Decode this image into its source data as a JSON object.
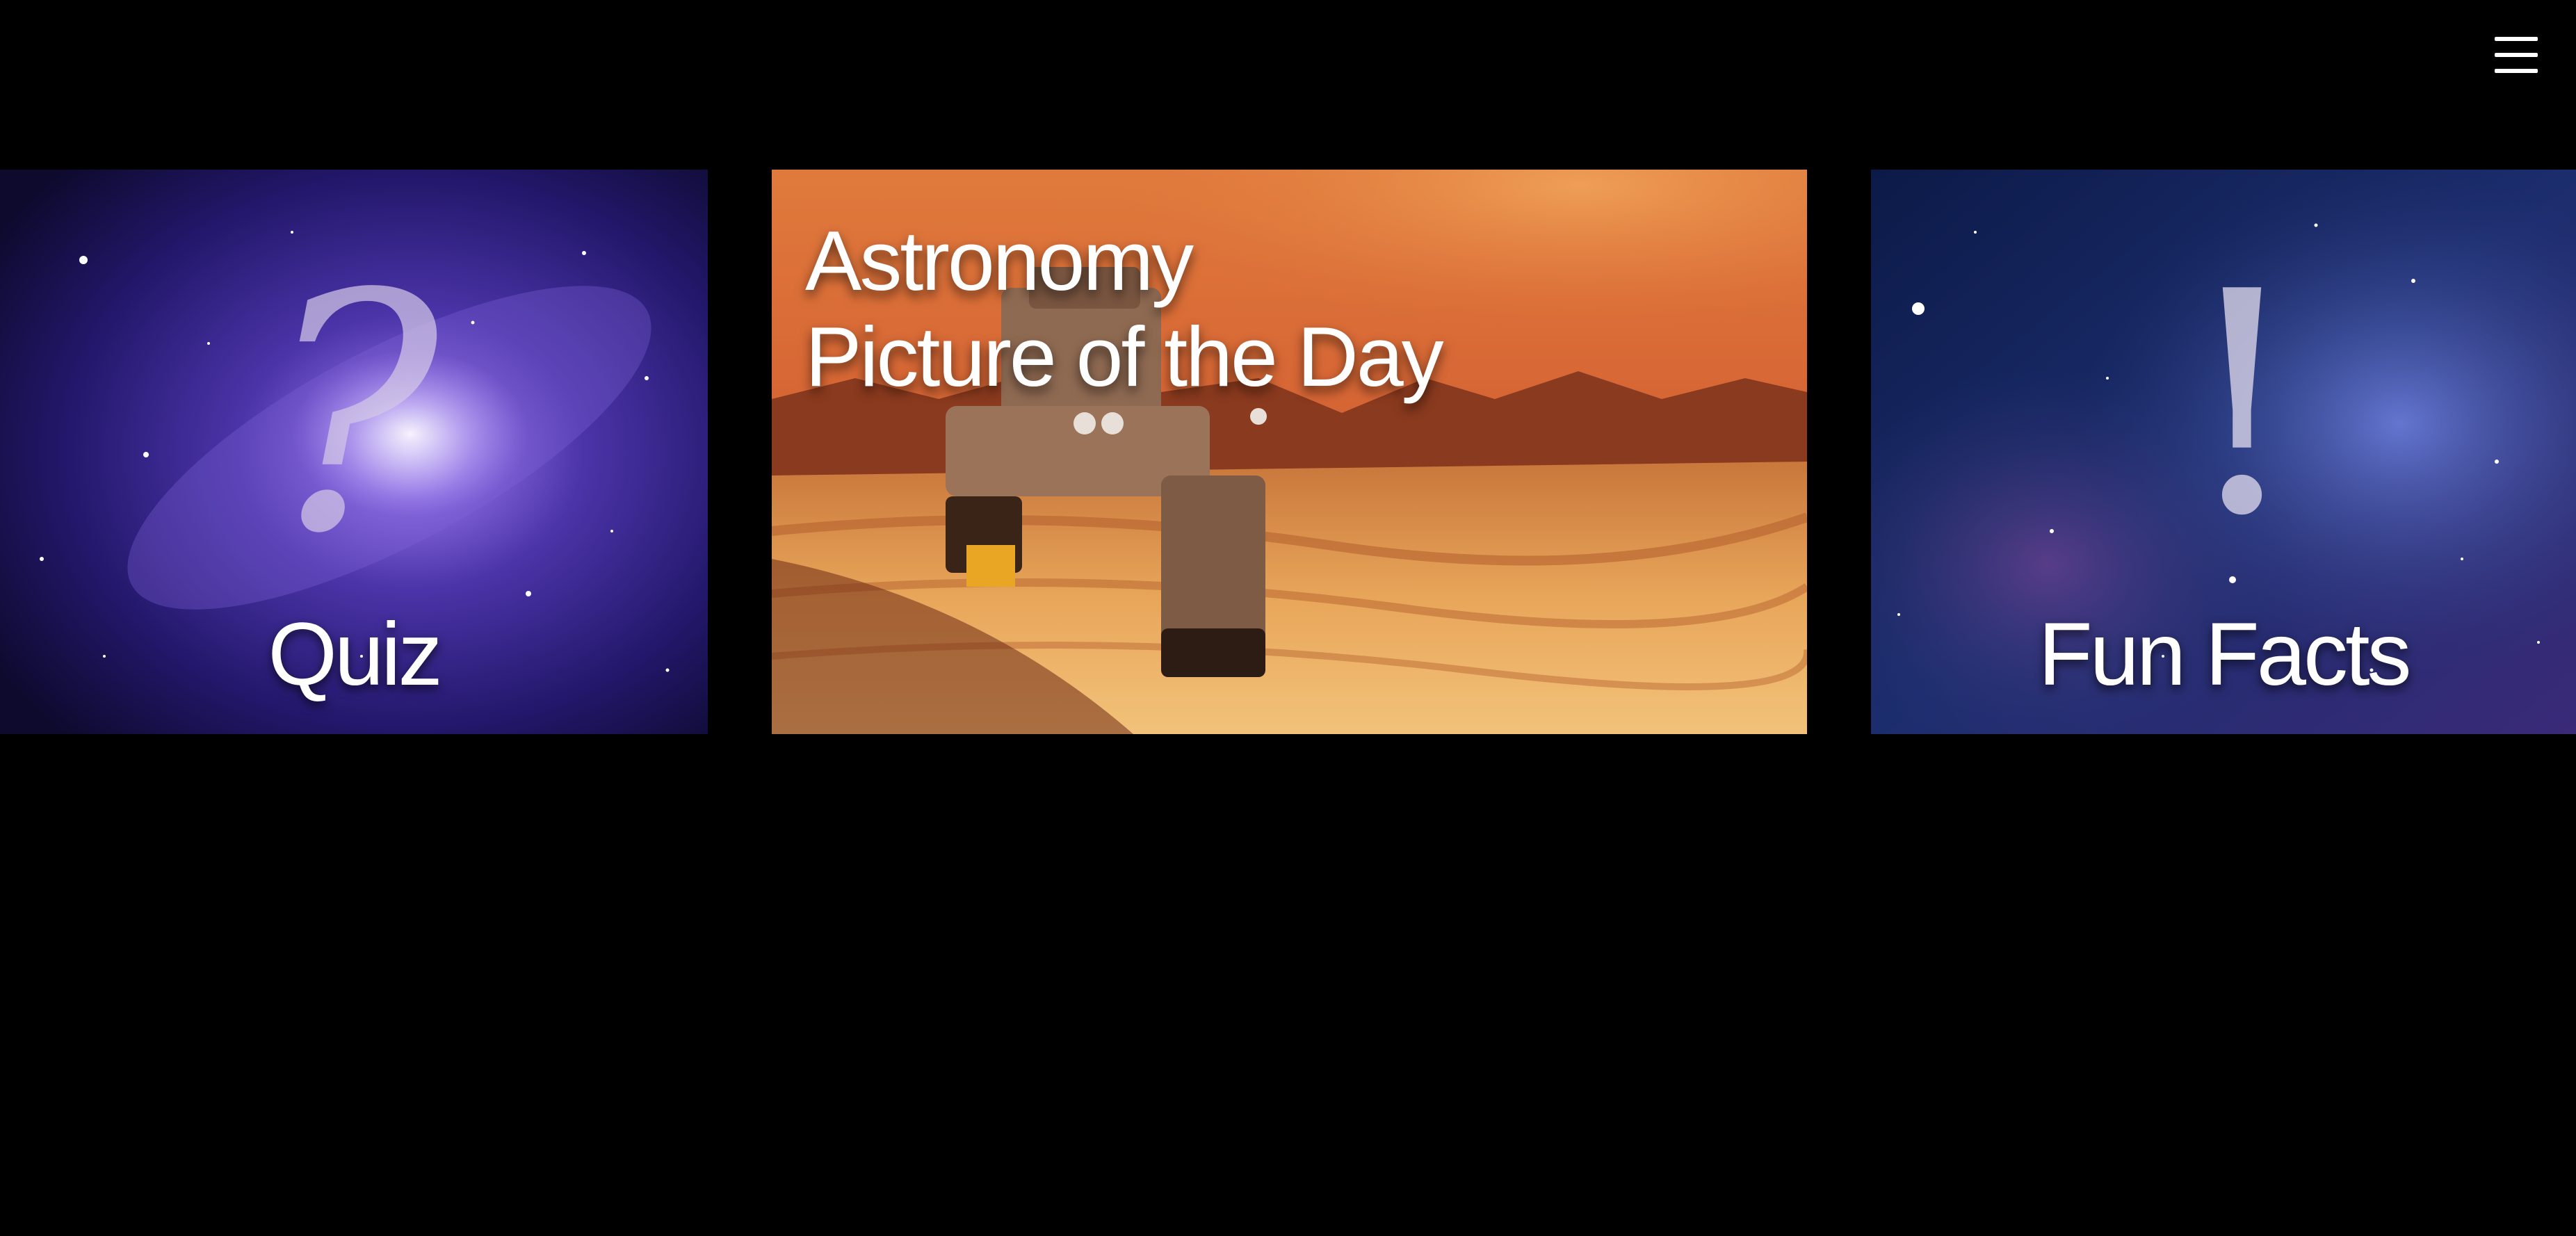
{
  "header": {
    "menu_icon": "hamburger-menu-icon"
  },
  "cards": {
    "quiz": {
      "label": "Quiz",
      "symbol": "?",
      "background": "purple spiral galaxy"
    },
    "apod": {
      "title_line1": "Astronomy",
      "title_line2": "Picture of the Day",
      "background": "rover on orange desert planet"
    },
    "fun_facts": {
      "label": "Fun Facts",
      "symbol": "!",
      "background": "blue nebula starfield"
    }
  },
  "colors": {
    "page_background": "#000000",
    "text": "#ffffff",
    "quiz_accent": "#4a3a9c",
    "apod_accent": "#d9602e",
    "facts_accent": "#2a3a7c"
  }
}
